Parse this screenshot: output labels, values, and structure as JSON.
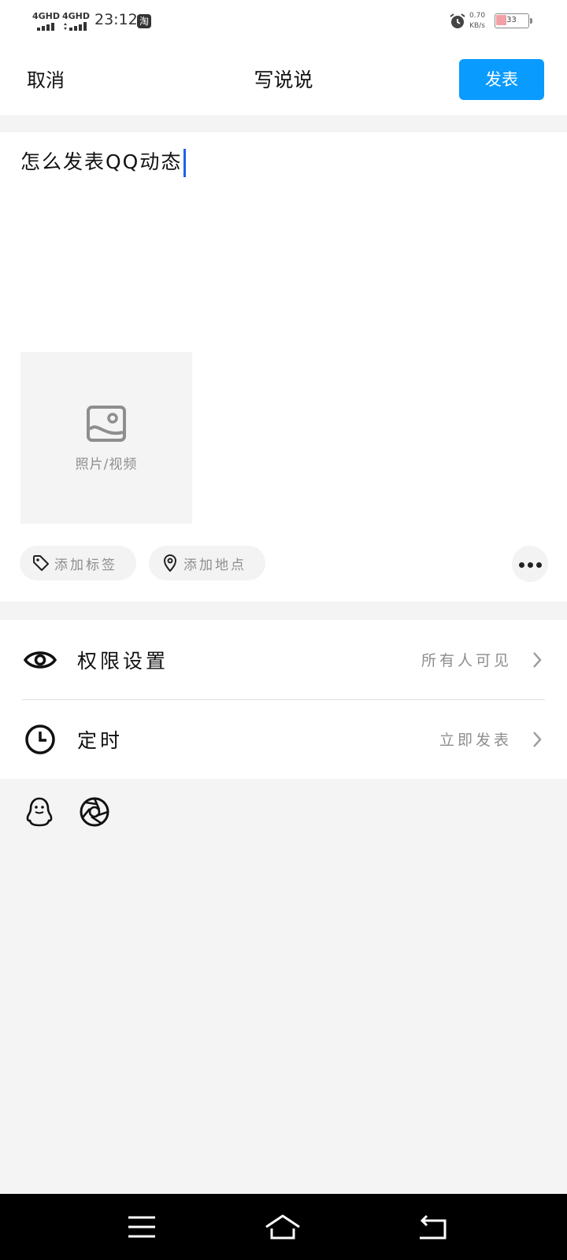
{
  "status_bar": {
    "network1": "4GHD",
    "network2": "4GHD",
    "time": "23:12",
    "app_badge": "淘",
    "speed_value": "0.70",
    "speed_unit": "KB/s",
    "battery": "33",
    "battery_level": 0.33
  },
  "header": {
    "cancel_label": "取消",
    "title": "写说说",
    "publish_label": "发表"
  },
  "compose": {
    "text": "怎么发表QQ动态",
    "media_label": "照片/视频",
    "add_tag_label": "添加标签",
    "add_location_label": "添加地点"
  },
  "settings": {
    "permission": {
      "label": "权限设置",
      "value": "所有人可见"
    },
    "schedule": {
      "label": "定时",
      "value": "立即发表"
    }
  },
  "share": {
    "icons": [
      "qq-penguin-icon",
      "camera-shutter-icon"
    ]
  },
  "nav": {
    "icons": [
      "menu-icon",
      "home-icon",
      "back-icon"
    ]
  },
  "colors": {
    "accent": "#0a9bff",
    "caret": "#1e62e8",
    "background": "#f4f4f4",
    "muted_text": "#8e8e8e"
  }
}
